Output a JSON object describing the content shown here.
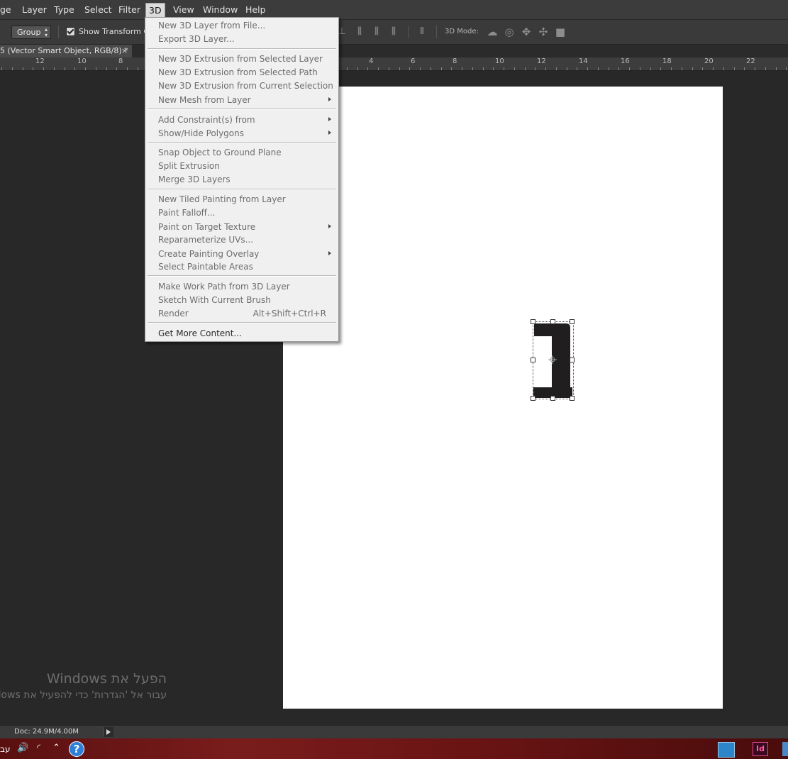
{
  "menubar": {
    "items": [
      "ge",
      "Layer",
      "Type",
      "Select",
      "Filter",
      "3D",
      "View",
      "Window",
      "Help"
    ],
    "active": "3D"
  },
  "options": {
    "group_select": "Group",
    "show_transform": "Show Transform Con",
    "mode_label": "3D Mode:"
  },
  "document": {
    "tab_title": "5 (Vector Smart Object, RGB/8) *",
    "tab_close": "×"
  },
  "ruler": {
    "left_labels": [
      "12",
      "10",
      "8"
    ],
    "right_labels": [
      "4",
      "6",
      "8",
      "10",
      "12",
      "14",
      "16",
      "18",
      "20",
      "22"
    ]
  },
  "menu3d": {
    "items": [
      {
        "label": "New 3D Layer from File...",
        "enabled": false
      },
      {
        "label": "Export 3D Layer...",
        "enabled": false
      },
      {
        "label": "New 3D Extrusion from Selected Layer",
        "enabled": false
      },
      {
        "label": "New 3D Extrusion from Selected Path",
        "enabled": false
      },
      {
        "label": "New 3D Extrusion from Current Selection",
        "enabled": false
      },
      {
        "label": "New Mesh from Layer",
        "enabled": false,
        "submenu": true
      },
      {
        "label": "Add Constraint(s) from",
        "enabled": false,
        "submenu": true
      },
      {
        "label": "Show/Hide Polygons",
        "enabled": false,
        "submenu": true
      },
      {
        "label": "Snap Object to Ground Plane",
        "enabled": false
      },
      {
        "label": "Split Extrusion",
        "enabled": false
      },
      {
        "label": "Merge 3D Layers",
        "enabled": false
      },
      {
        "label": "New Tiled Painting from Layer",
        "enabled": false
      },
      {
        "label": "Paint Falloff...",
        "enabled": false
      },
      {
        "label": "Paint on Target Texture",
        "enabled": false,
        "submenu": true
      },
      {
        "label": "Reparameterize UVs...",
        "enabled": false
      },
      {
        "label": "Create Painting Overlay",
        "enabled": false,
        "submenu": true
      },
      {
        "label": "Select Paintable Areas",
        "enabled": false
      },
      {
        "label": "Make Work Path from 3D Layer",
        "enabled": false
      },
      {
        "label": "Sketch With Current Brush",
        "enabled": false
      },
      {
        "label": "Render",
        "enabled": false,
        "shortcut": "Alt+Shift+Ctrl+R"
      },
      {
        "label": "Get More Content...",
        "enabled": true
      }
    ]
  },
  "watermark": {
    "title": "הפעל את Windows",
    "subtitle": "עבור אל 'הגדרות' כדי להפעיל את Windows"
  },
  "status": {
    "doc": "Doc: 24.9M/4.00M"
  },
  "taskbar": {
    "lang": "עב",
    "help": "?",
    "app_id": "Id"
  },
  "colors": {
    "menu_bg": "#f0f0f0",
    "canvas": "#ffffff",
    "workspace": "#282828"
  }
}
